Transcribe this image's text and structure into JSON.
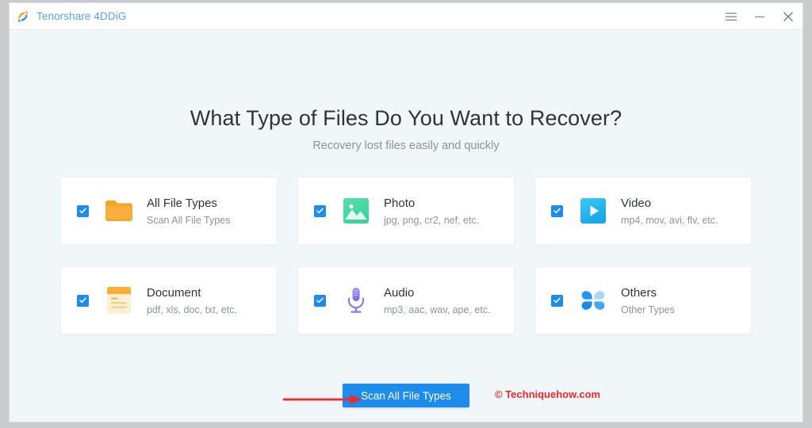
{
  "window": {
    "app_title": "Tenorshare 4DDiG",
    "logo_icon": "tenorshare-4ddig-logo",
    "controls": [
      {
        "name": "menu",
        "icon": "hamburger-menu-icon"
      },
      {
        "name": "minimize",
        "icon": "minimize-icon"
      },
      {
        "name": "close",
        "icon": "close-icon"
      }
    ]
  },
  "main": {
    "title": "What Type of Files Do You Want to Recover?",
    "subtitle": "Recovery lost files easily and quickly",
    "file_types": [
      {
        "name": "All File Types",
        "description": "Scan All File Types",
        "icon": "folder-icon",
        "checked": true,
        "color": "#f5a623"
      },
      {
        "name": "Photo",
        "description": "jpg, png, cr2, nef, etc.",
        "icon": "photo-icon",
        "checked": true,
        "color": "#4dd4a0"
      },
      {
        "name": "Video",
        "description": "mp4, mov, avi, flv, etc.",
        "icon": "video-play-icon",
        "checked": true,
        "color": "#22b4e8"
      },
      {
        "name": "Document",
        "description": "pdf, xls, doc, txt, etc.",
        "icon": "document-icon",
        "checked": true,
        "color": "#fbb034"
      },
      {
        "name": "Audio",
        "description": "mp3, aac, wav, ape, etc.",
        "icon": "microphone-icon",
        "checked": true,
        "color": "#8d7bf0"
      },
      {
        "name": "Others",
        "description": "Other Types",
        "icon": "four-petals-icon",
        "checked": true,
        "color": "#2196f3"
      }
    ]
  },
  "footer": {
    "scan_button_label": "Scan All File Types",
    "watermark": "© Techniquehow.com",
    "annotation": "red-arrow-pointing-to-scan-button"
  },
  "colors": {
    "accent": "#1d8ceb",
    "title_text": "#5ba3e0",
    "page_bg": "#f1f6f9",
    "card_bg": "#ffffff",
    "annotation_red": "#f0282d"
  }
}
